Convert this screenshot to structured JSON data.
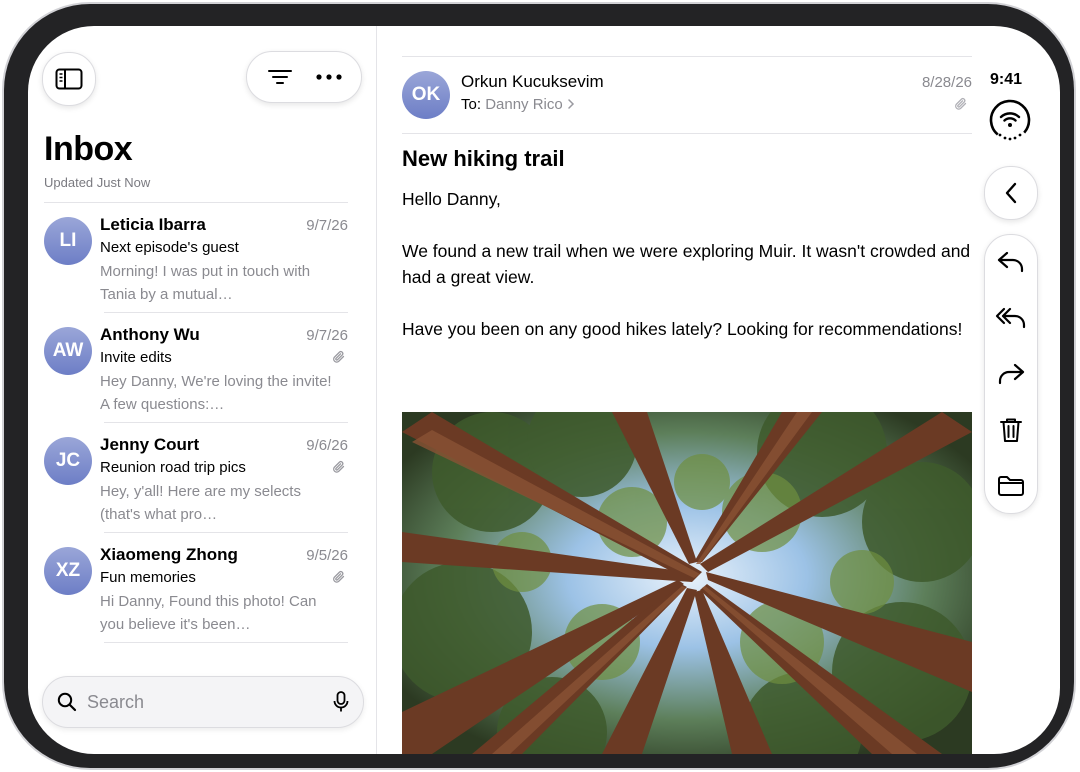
{
  "status": {
    "time": "9:41"
  },
  "sidebar": {
    "title": "Inbox",
    "updated": "Updated Just Now",
    "search_placeholder": "Search",
    "messages": [
      {
        "initials": "LI",
        "sender": "Leticia Ibarra",
        "date": "9/7/26",
        "subject": "Next episode's guest",
        "preview": "Morning! I was put in touch with Tania by a mutual…",
        "attachment": false
      },
      {
        "initials": "AW",
        "sender": "Anthony Wu",
        "date": "9/7/26",
        "subject": "Invite edits",
        "preview": "Hey Danny, We're loving the invite! A few questions:…",
        "attachment": true
      },
      {
        "initials": "JC",
        "sender": "Jenny Court",
        "date": "9/6/26",
        "subject": "Reunion road trip pics",
        "preview": "Hey, y'all! Here are my selects (that's what pro…",
        "attachment": true
      },
      {
        "initials": "XZ",
        "sender": "Xiaomeng Zhong",
        "date": "9/5/26",
        "subject": "Fun memories",
        "preview": "Hi Danny, Found this photo! Can you believe it's been…",
        "attachment": true
      }
    ]
  },
  "message": {
    "initials": "OK",
    "from": "Orkun Kucuksevim",
    "to_label": "To:",
    "recipient": "Danny Rico",
    "date": "8/28/26",
    "subject": "New hiking trail",
    "greeting": "Hello Danny,",
    "paragraph1": "We found a new trail when we were exploring Muir. It wasn't crowded and had a great view.",
    "paragraph2": "Have you been on any good hikes lately? Looking for recommendations!"
  },
  "colors": {
    "avatar": "#7f8dcf",
    "secondary_text": "#8a8a90",
    "divider": "#e4e4e8"
  }
}
